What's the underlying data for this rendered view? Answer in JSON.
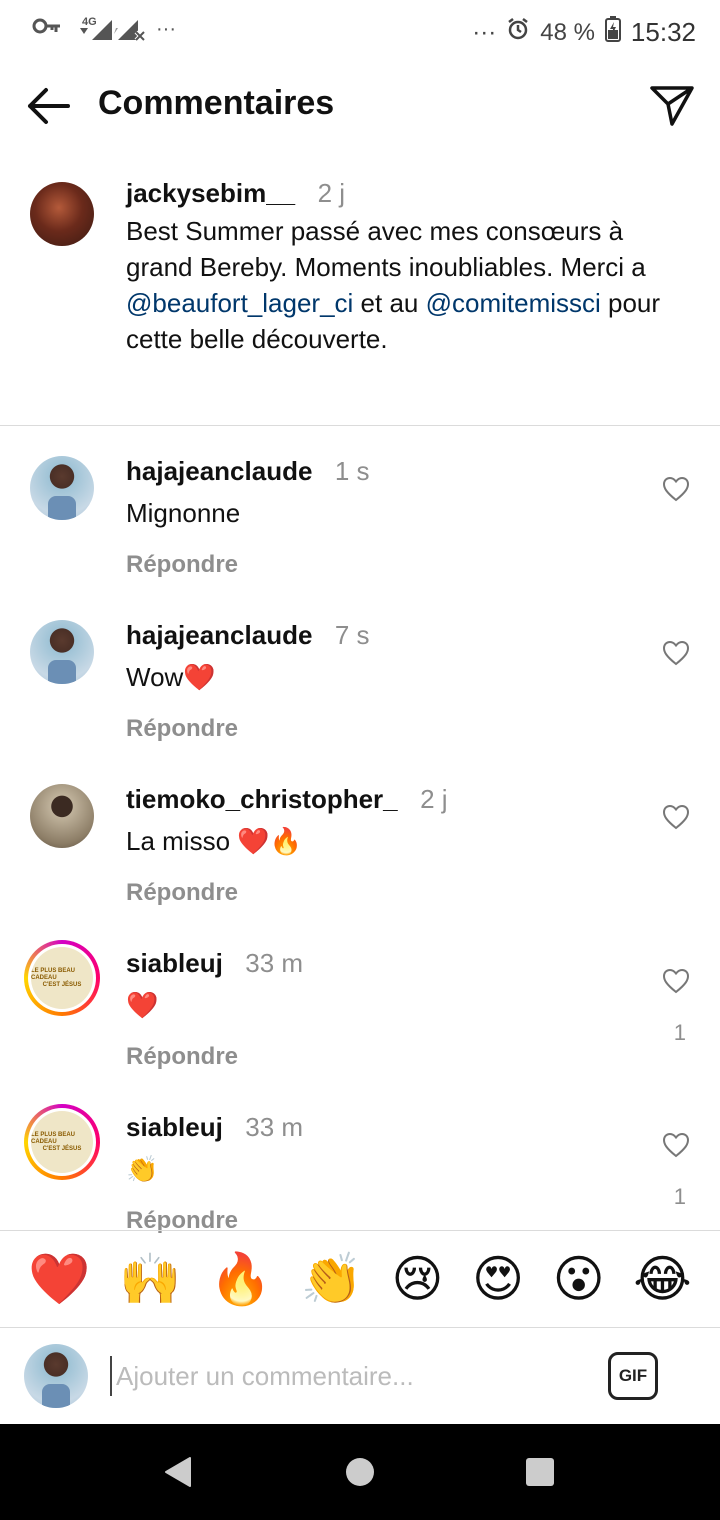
{
  "status_bar": {
    "network": "4G",
    "more_indicator": "···",
    "battery": "48 %",
    "time": "15:32",
    "icons": [
      "key-icon",
      "signal-icon",
      "signal-x-icon",
      "alarm-icon",
      "battery-icon"
    ]
  },
  "header": {
    "title": "Commentaires"
  },
  "caption": {
    "username": "jackysebim__",
    "time": "2 j",
    "text_parts": {
      "part1": "Best Summer passé avec mes consœurs à grand Bereby. Moments inoubliables. Merci a ",
      "mention1": "@beaufort_lager_ci",
      "part2": " et au ",
      "mention2": "@comitemissci",
      "part3": " pour cette belle découverte."
    }
  },
  "comments": [
    {
      "username": "hajajeanclaude",
      "time": "1 s",
      "text": "Mignonne",
      "reply": "Répondre",
      "likes": ""
    },
    {
      "username": "hajajeanclaude",
      "time": "7 s",
      "text": "Wow❤️",
      "reply": "Répondre",
      "likes": ""
    },
    {
      "username": "tiemoko_christopher_",
      "time": "2 j",
      "text": "La misso ❤️🔥",
      "reply": "Répondre",
      "likes": ""
    },
    {
      "username": "siableuj",
      "time": "33 m",
      "text": "❤️",
      "reply": "Répondre",
      "likes": "1"
    },
    {
      "username": "siableuj",
      "time": "33 m",
      "text": "👏",
      "reply": "Répondre",
      "likes": "1"
    }
  ],
  "story_avatar_text": {
    "line1": "LE PLUS BEAU CADEAU",
    "line2": "C'EST JÉSUS"
  },
  "emoji_bar": [
    "❤️",
    "🙌",
    "🔥",
    "👏",
    "😢",
    "😍",
    "😮",
    "😂"
  ],
  "input": {
    "placeholder": "Ajouter un commentaire...",
    "gif_label": "GIF"
  },
  "colors": {
    "mention": "#00376b",
    "secondary_text": "#8e8e8e",
    "divider": "#dbdbdb"
  }
}
